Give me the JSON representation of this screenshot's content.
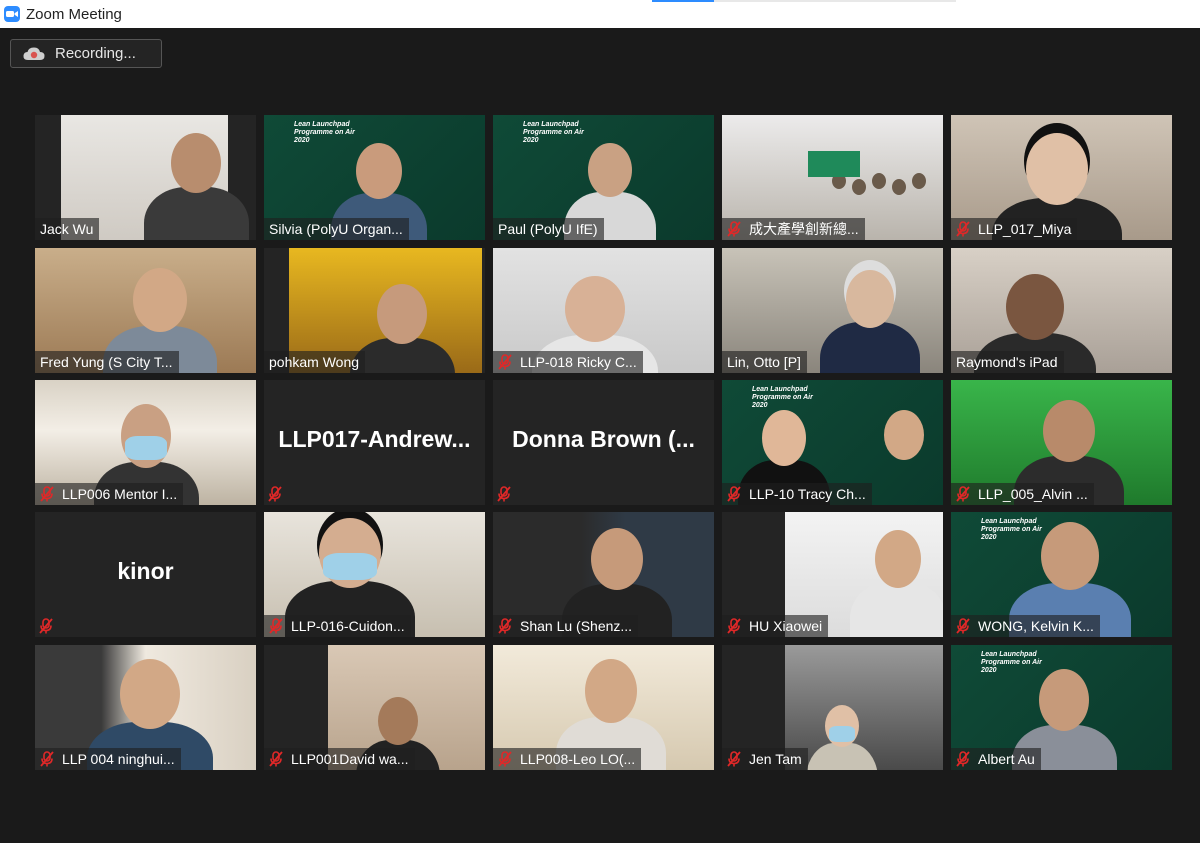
{
  "window": {
    "title": "Zoom Meeting",
    "icon": "zoom-camera-icon",
    "accent": "#2d8cff"
  },
  "recording": {
    "label": "Recording...",
    "icon": "cloud-recording-icon",
    "color": "#d9534f"
  },
  "colors": {
    "active_speaker_border": "#d9e86b",
    "muted_icon": "#e02828",
    "tile_bg": "#242424",
    "background": "#1a1a1a"
  },
  "participants": [
    {
      "name": "Jack Wu",
      "muted": false
    },
    {
      "name": "Silvia (PolyU Organ...",
      "muted": false,
      "active_speaker": true,
      "background": "Lean Launchpad Programme on Air 2020"
    },
    {
      "name": "Paul (PolyU IfE)",
      "muted": false,
      "background": "Lean Launchpad Programme on Air 2020"
    },
    {
      "name": "成大產學創新總...",
      "muted": true
    },
    {
      "name": "LLP_017_Miya",
      "muted": true
    },
    {
      "name": "Fred Yung (S City T...",
      "muted": false
    },
    {
      "name": "pohkam Wong",
      "muted": false
    },
    {
      "name": "LLP-018 Ricky C...",
      "muted": true
    },
    {
      "name": "Lin, Otto [P]",
      "muted": false
    },
    {
      "name": "Raymond's iPad",
      "muted": false
    },
    {
      "name": "LLP006 Mentor I...",
      "muted": true
    },
    {
      "name": "",
      "big_name": "LLP017-Andrew...",
      "muted": true,
      "video_off": true
    },
    {
      "name": "",
      "big_name": "Donna  Brown  (...",
      "muted": true,
      "video_off": true
    },
    {
      "name": "LLP-10 Tracy Ch...",
      "muted": true,
      "background": "Lean Launchpad Programme on Air 2020"
    },
    {
      "name": "LLP_005_Alvin ...",
      "muted": true
    },
    {
      "name": "",
      "big_name": "kinor",
      "muted": true,
      "video_off": true
    },
    {
      "name": "LLP-016-Cuidon...",
      "muted": true
    },
    {
      "name": "Shan Lu (Shenz...",
      "muted": true
    },
    {
      "name": "HU Xiaowei",
      "muted": true
    },
    {
      "name": "WONG, Kelvin K...",
      "muted": true,
      "background": "Lean Launchpad Programme on Air 2020"
    },
    {
      "name": "LLP 004 ninghui...",
      "muted": true
    },
    {
      "name": "LLP001David wa...",
      "muted": true
    },
    {
      "name": "LLP008-Leo LO(...",
      "muted": true
    },
    {
      "name": "Jen Tam",
      "muted": true
    },
    {
      "name": "Albert Au",
      "muted": true,
      "background": "Lean Launchpad Programme on Air 2020"
    }
  ]
}
